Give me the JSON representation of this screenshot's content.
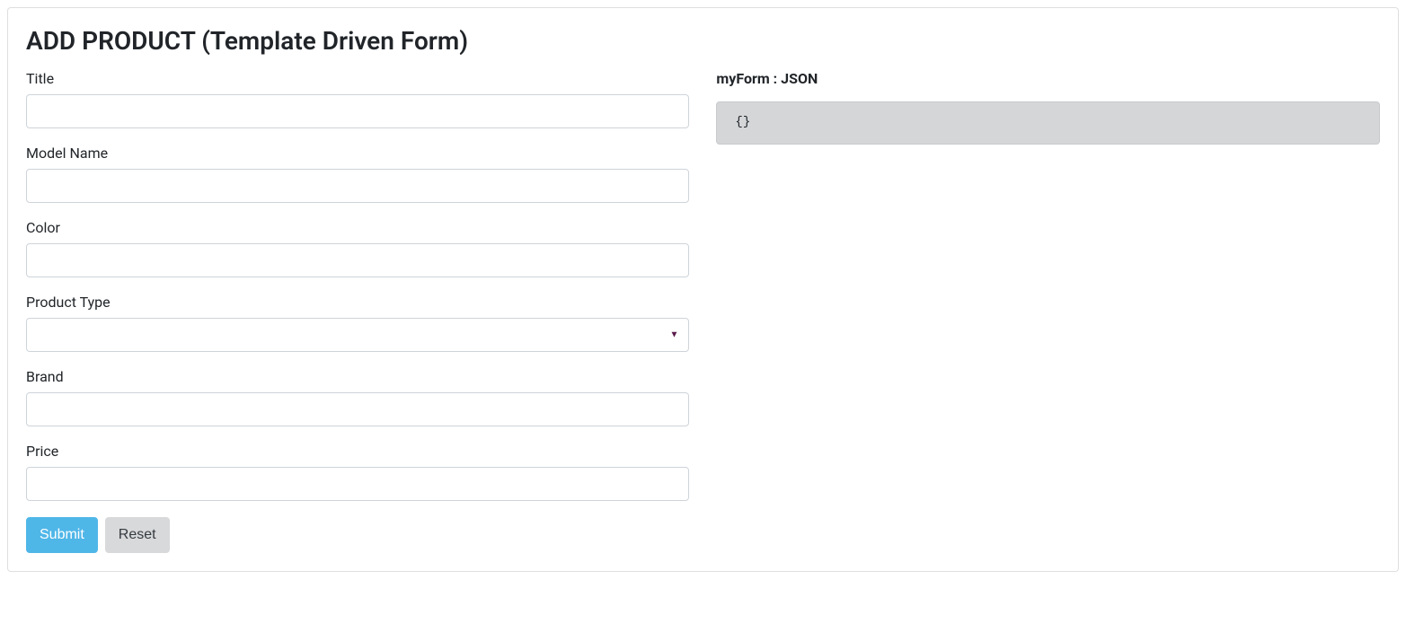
{
  "header": {
    "title": "ADD PRODUCT (Template Driven Form)"
  },
  "form": {
    "fields": {
      "title": {
        "label": "Title",
        "value": ""
      },
      "modelName": {
        "label": "Model Name",
        "value": ""
      },
      "color": {
        "label": "Color",
        "value": ""
      },
      "productType": {
        "label": "Product Type",
        "value": ""
      },
      "brand": {
        "label": "Brand",
        "value": ""
      },
      "price": {
        "label": "Price",
        "value": ""
      }
    },
    "buttons": {
      "submit": "Submit",
      "reset": "Reset"
    }
  },
  "jsonPanel": {
    "label": "myForm : JSON",
    "content": "{}"
  }
}
